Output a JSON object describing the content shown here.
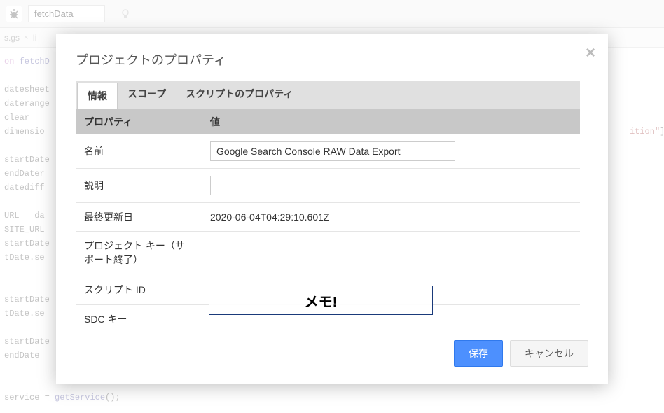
{
  "toolbar": {
    "function_select": "fetchData"
  },
  "file_tabs": {
    "tab1": "s.gs"
  },
  "code": {
    "line1_kw": "on",
    "line1_fn": " fetchD",
    "vars1": "datesheet",
    "vars2": "daterange",
    "vars3": "clear = ",
    "vars4": "dimensio",
    "vars5": "startDate",
    "vars6": "endDater",
    "vars7": "datediff",
    "vars8": "URL = da",
    "vars9": "SITE_URL",
    "vars10": "startDate",
    "vars11": "tDate",
    "vars11b": ".se",
    "vars12": "startDate",
    "vars13": "tDate",
    "vars13b": ".se",
    "vars14": "startDate",
    "vars15": "endDate ",
    "line_last_var": "service",
    "line_last_op": " = ",
    "line_last_fn": "getService",
    "line_last_paren": "();",
    "right_str": "ition\"",
    "right_bracket": "]"
  },
  "modal": {
    "title": "プロジェクトのプロパティ",
    "tabs": {
      "info": "情報",
      "scope": "スコープ",
      "script_props": "スクリプトのプロパティ"
    },
    "header": {
      "property": "プロパティ",
      "value": "値"
    },
    "rows": {
      "name_label": "名前",
      "name_value": "Google Search Console RAW Data Export",
      "desc_label": "説明",
      "desc_value": "",
      "lastmod_label": "最終更新日",
      "lastmod_value": "2020-06-04T04:29:10.601Z",
      "projkey_label": "プロジェクト キー（サポート終了）",
      "scriptid_label": "スクリプト ID",
      "sdckey_label": "SDC キー"
    },
    "annotation": "メモ!",
    "buttons": {
      "save": "保存",
      "cancel": "キャンセル"
    }
  }
}
